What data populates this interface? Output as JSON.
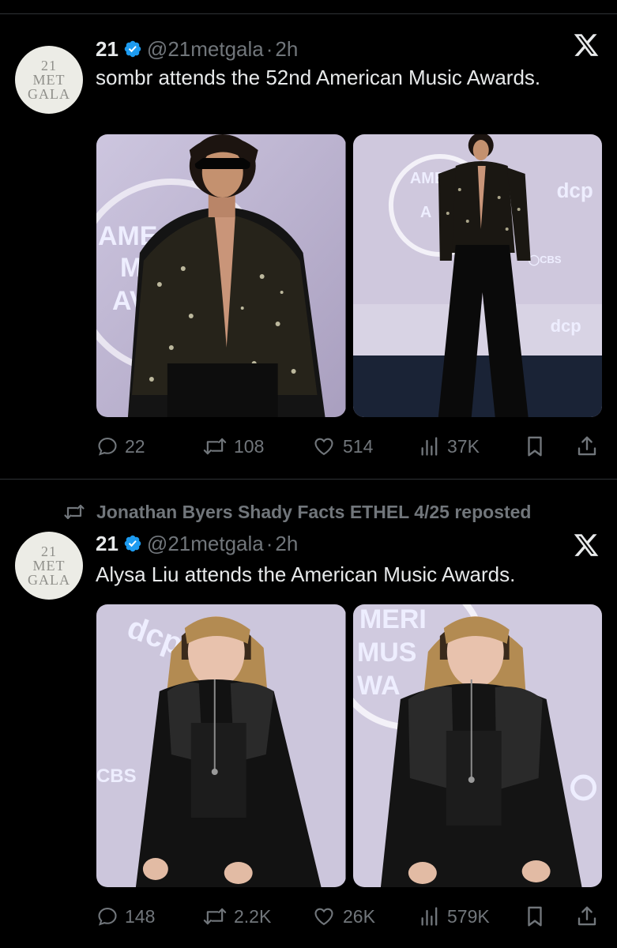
{
  "tweets": [
    {
      "avatar_lines": [
        "21",
        "MET",
        "GALA"
      ],
      "name": "21",
      "handle": "@21metgala",
      "separator": "·",
      "time": "2h",
      "text": "sombr attends the 52nd American Music Awards.",
      "stats": {
        "replies": "22",
        "reposts": "108",
        "likes": "514",
        "views": "37K"
      }
    },
    {
      "repost_label": "Jonathan Byers Shady Facts ETHEL 4/25 reposted",
      "avatar_lines": [
        "21",
        "MET",
        "GALA"
      ],
      "name": "21",
      "handle": "@21metgala",
      "separator": "·",
      "time": "2h",
      "text": "Alysa Liu attends the American Music Awards.",
      "stats": {
        "replies": "148",
        "reposts": "2.2K",
        "likes": "26K",
        "views": "579K"
      }
    }
  ],
  "colors": {
    "verified": "#1d9bf0",
    "muted": "#71767b",
    "text": "#e7e9ea",
    "background": "#000000"
  },
  "icons": [
    "verified-badge-icon",
    "x-logo-icon",
    "reply-icon",
    "repost-icon",
    "like-icon",
    "views-icon",
    "bookmark-icon",
    "share-icon"
  ]
}
